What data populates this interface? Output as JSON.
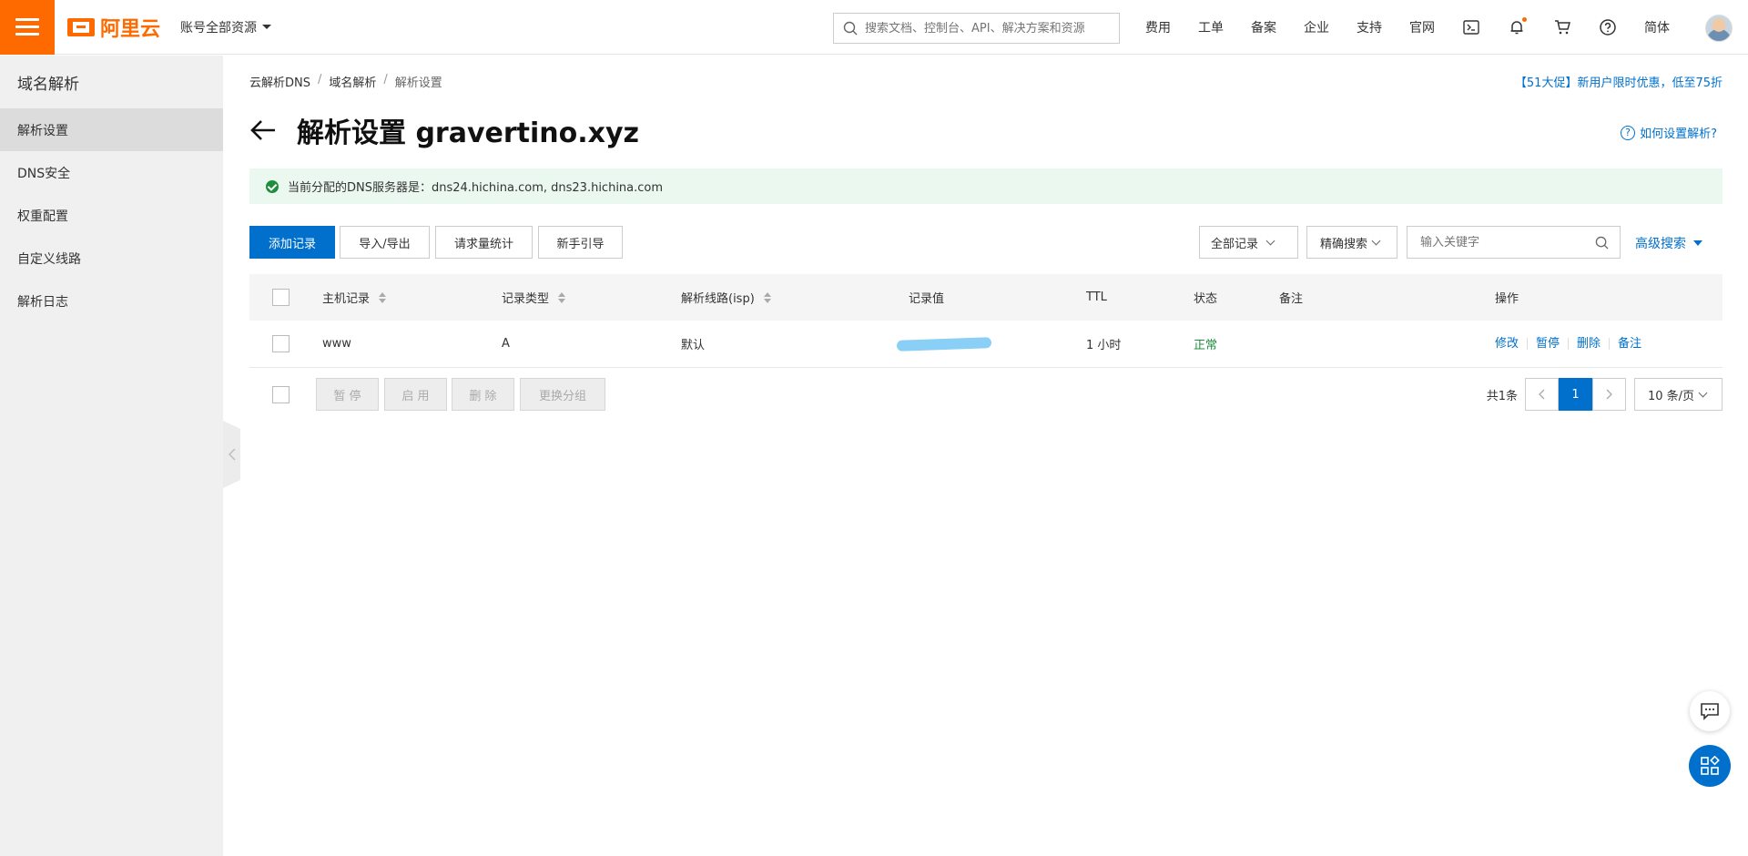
{
  "topbar": {
    "brand": "阿里云",
    "account_scope": "账号全部资源",
    "search_placeholder": "搜索文档、控制台、API、解决方案和资源",
    "nav": [
      "费用",
      "工单",
      "备案",
      "企业",
      "支持",
      "官网"
    ],
    "language": "简体"
  },
  "sidebar": {
    "title": "域名解析",
    "items": [
      {
        "label": "解析设置",
        "active": true
      },
      {
        "label": "DNS安全",
        "active": false
      },
      {
        "label": "权重配置",
        "active": false
      },
      {
        "label": "自定义线路",
        "active": false
      },
      {
        "label": "解析日志",
        "active": false
      }
    ]
  },
  "breadcrumb": [
    "云解析DNS",
    "域名解析",
    "解析设置"
  ],
  "promo": "【51大促】新用户限时优惠，低至75折",
  "page": {
    "title": "解析设置 gravertino.xyz",
    "help": "如何设置解析?",
    "notice": "当前分配的DNS服务器是：dns24.hichina.com, dns23.hichina.com"
  },
  "toolbar": {
    "add": "添加记录",
    "import_export": "导入/导出",
    "stats": "请求量统计",
    "guide": "新手引导",
    "filter_all": "全部记录",
    "exact_search": "精确搜索",
    "keyword_placeholder": "输入关键字",
    "advanced": "高级搜索"
  },
  "table": {
    "headers": [
      "主机记录",
      "记录类型",
      "解析线路(isp)",
      "记录值",
      "TTL",
      "状态",
      "备注",
      "操作"
    ],
    "rows": [
      {
        "host": "www",
        "type": "A",
        "line": "默认",
        "value": "",
        "ttl": "1 小时",
        "status": "正常",
        "remark": "",
        "ops": [
          "修改",
          "暂停",
          "删除",
          "备注"
        ]
      }
    ]
  },
  "bulk": {
    "pause": "暂 停",
    "enable": "启 用",
    "delete": "删 除",
    "change_group": "更换分组"
  },
  "pager": {
    "total": "共1条",
    "current": "1",
    "page_size": "10 条/页"
  },
  "colors": {
    "brand_orange": "#ff6a00",
    "primary_blue": "#0070cc",
    "success_green": "#1e8e3e"
  }
}
